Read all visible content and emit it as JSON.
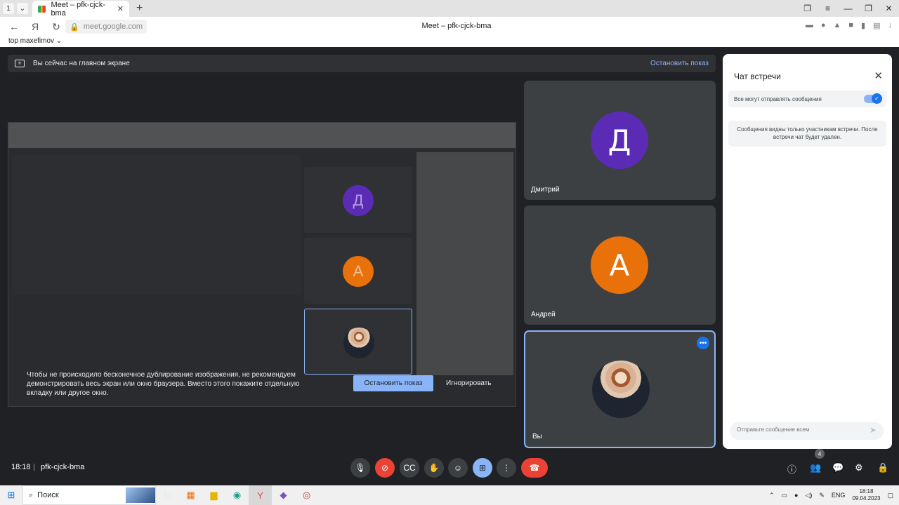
{
  "browser": {
    "tab_counter": "1",
    "tab_title": "Meet – pfk-cjck-bma",
    "url": "meet.google.com",
    "page_title": "Meet – pfk-cjck-bma",
    "bookmark": "top maxefimov"
  },
  "banner": {
    "text": "Вы сейчас на главном экране",
    "stop_label": "Остановить показ"
  },
  "share_preview": {
    "hint": "Чтобы не происходило бесконечное дублирование изображения, не рекомендуем демонстрировать весь экран или окно браузера. Вместо этого покажите отдельную вкладку или другое окно.",
    "stop_button": "Остановить показ",
    "ignore_button": "Игнорировать"
  },
  "participants": [
    {
      "initial": "Д",
      "name": "Дмитрий",
      "color": "#5b2bb5"
    },
    {
      "initial": "А",
      "name": "Андрей",
      "color": "#e8710a"
    },
    {
      "name": "Вы",
      "active": true
    }
  ],
  "chat": {
    "title": "Чат встречи",
    "toggle_label": "Все могут отправлять сообщения",
    "toggle_on": true,
    "notice": "Сообщения видны только участникам встречи. После встречи чат будет удален.",
    "compose_placeholder": "Отправьте сообщение всем"
  },
  "bottombar": {
    "time": "18:18",
    "separator": "|",
    "meeting_code": "pfk-cjck-bma",
    "people_count": "4"
  },
  "taskbar": {
    "search_label": "Поиск",
    "lang": "ENG",
    "time": "18:18",
    "date": "09.04.2023"
  }
}
